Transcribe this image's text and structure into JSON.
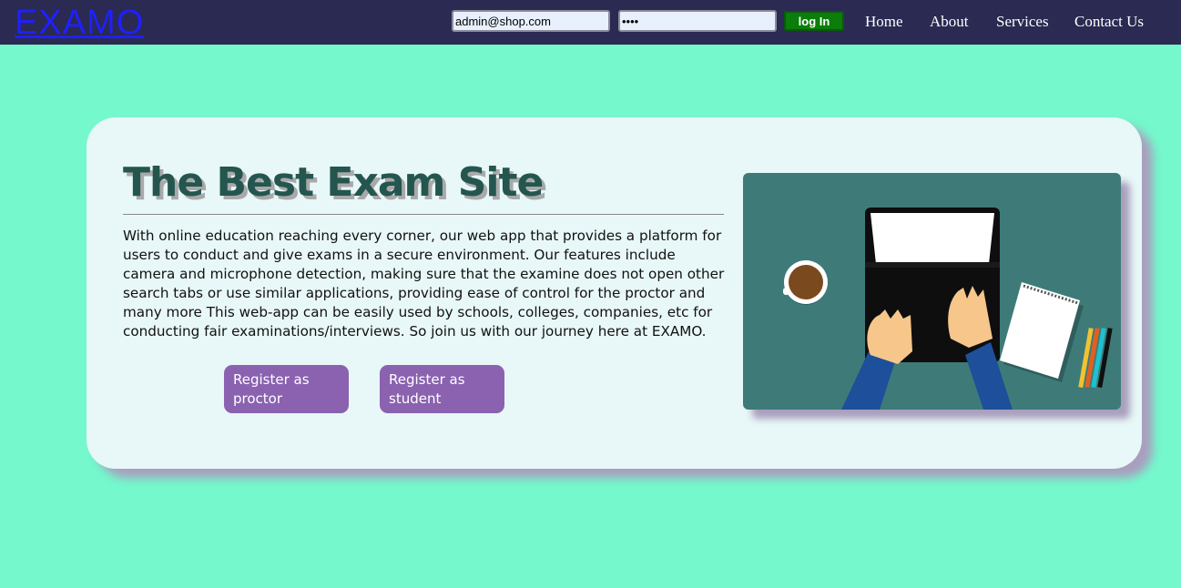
{
  "header": {
    "logo": "EXAMO",
    "email_value": "admin@shop.com",
    "password_value": "••••",
    "login_label": "log In",
    "nav": {
      "home": "Home",
      "about": "About",
      "services": "Services",
      "contact": "Contact Us"
    }
  },
  "hero": {
    "title": "The Best Exam Site",
    "description": "With online education reaching every corner, our web app that provides a platform for users to conduct and give exams in a secure environment. Our features include camera and microphone detection, making sure that the examine does not open other search tabs or use similar applications, providing ease of control for the proctor and many more This web-app can be easily used by schools, colleges, companies, etc for conducting fair examinations/interviews. So join us with our journey here at EXAMO.",
    "register_proctor_label": "Register as proctor",
    "register_student_label": "Register as student"
  },
  "colors": {
    "page_background": "#74f8cc",
    "navbar": "#2a2a52",
    "logo": "#1f1fff",
    "login_button": "#0a7d0a",
    "card_background": "#e8f7f7",
    "title": "#24564f",
    "register_button": "#8a62b0",
    "illustration_background": "#3e7b78"
  }
}
